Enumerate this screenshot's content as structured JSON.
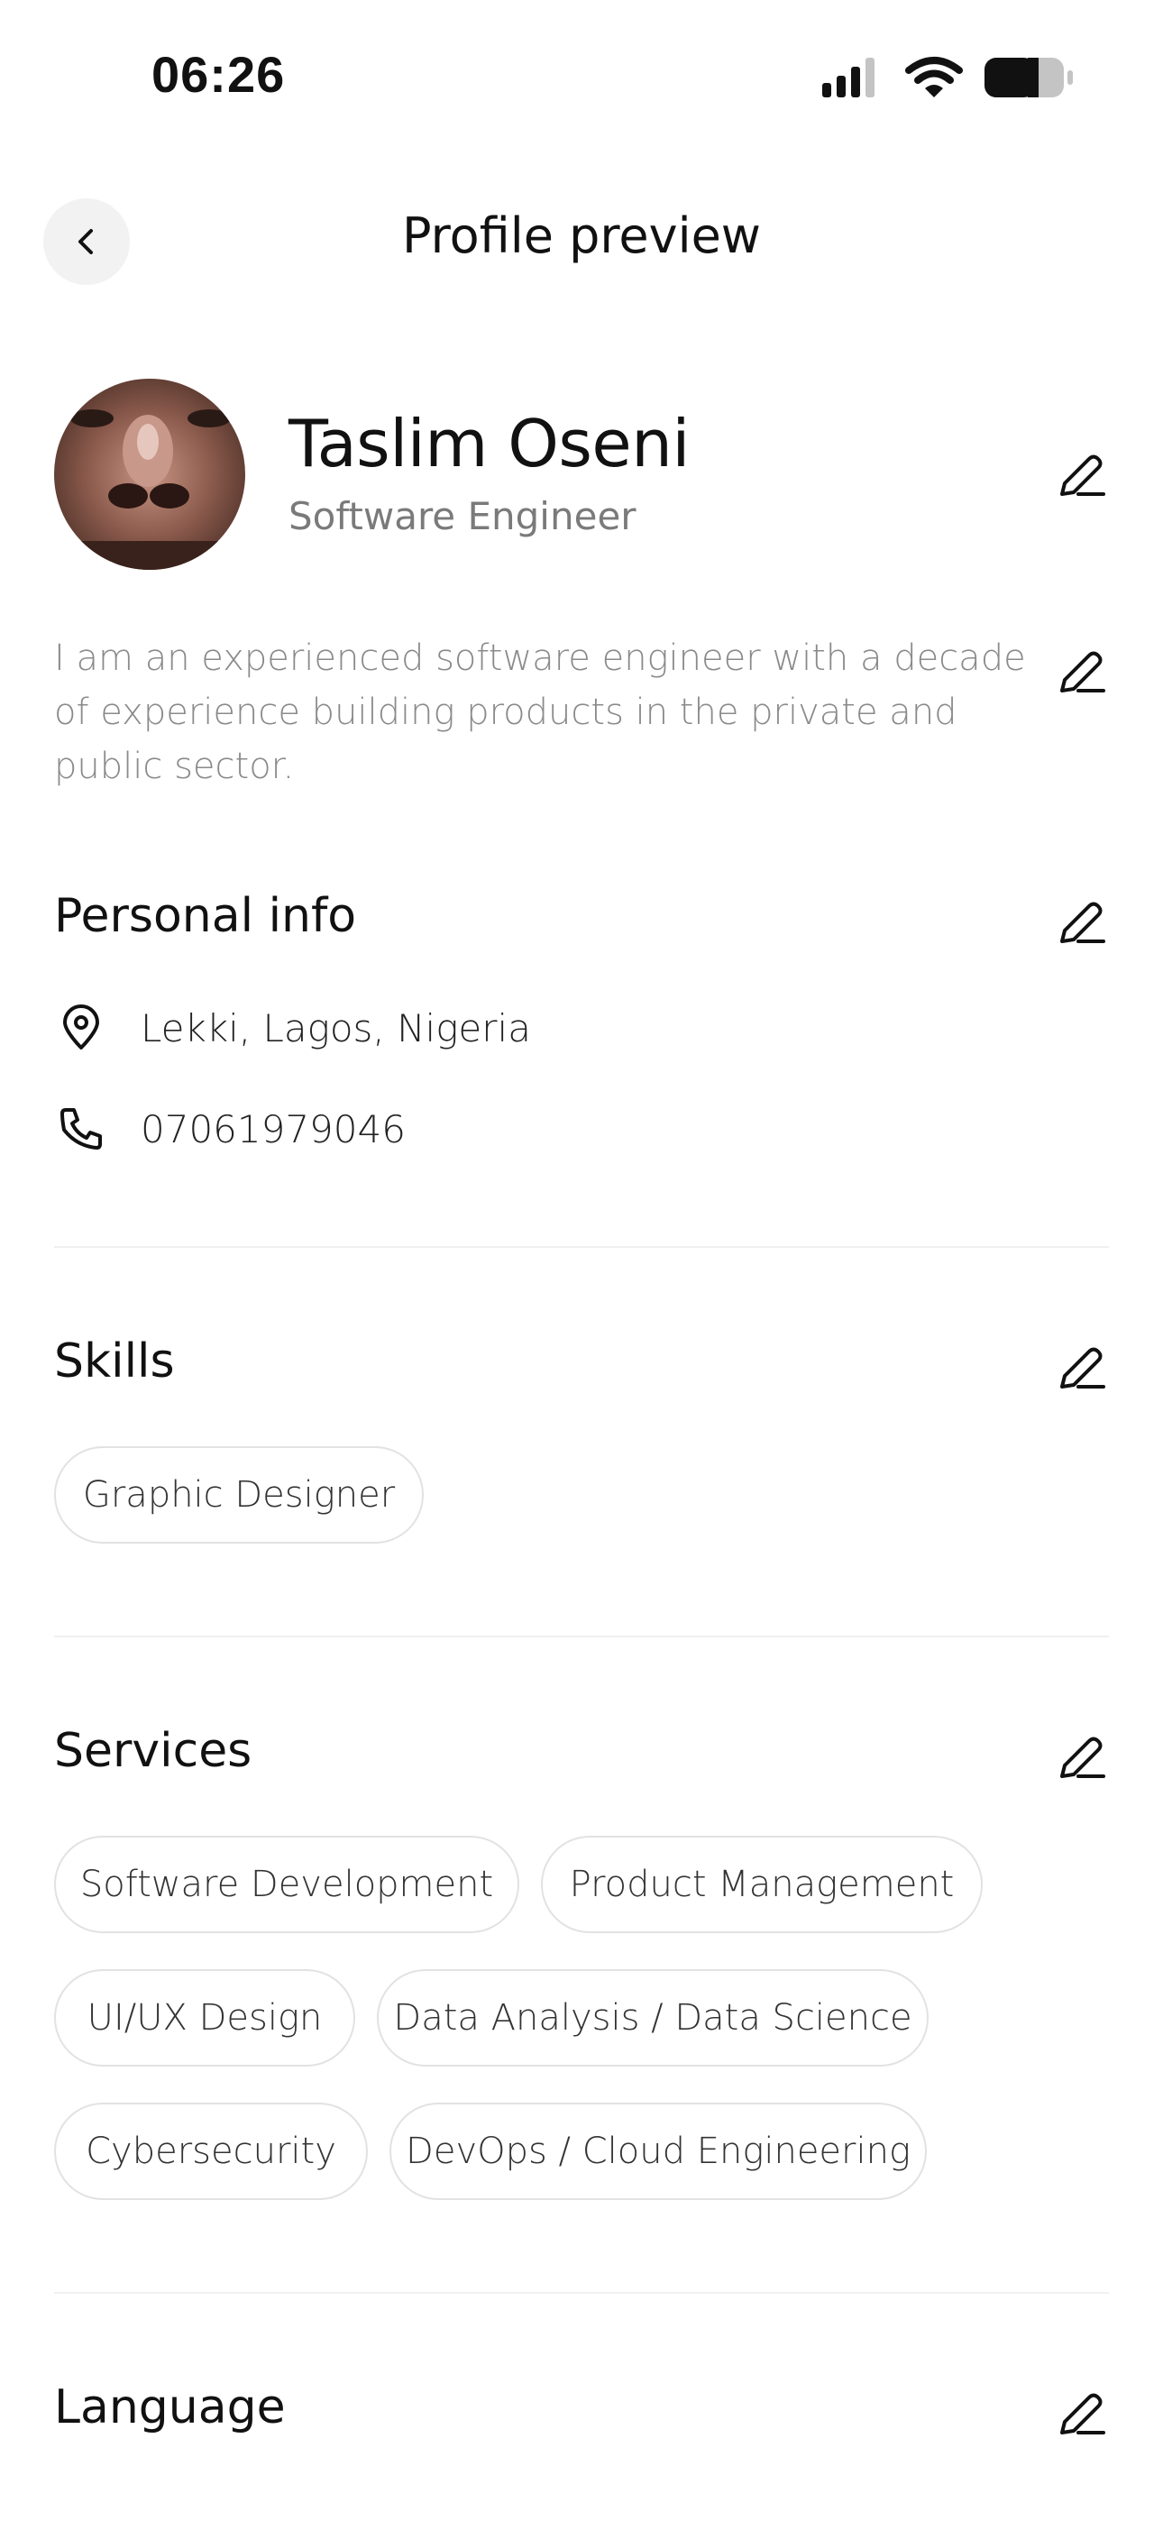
{
  "status_bar": {
    "time": "06:26"
  },
  "header": {
    "title": "Profile preview"
  },
  "profile": {
    "name": "Taslim Oseni",
    "job_title": "Software Engineer",
    "bio": "I am an experienced software engineer with a decade of experience building products in the private and public sector."
  },
  "personal_info": {
    "title": "Personal info",
    "location": "Lekki, Lagos, Nigeria",
    "phone": "07061979046"
  },
  "skills": {
    "title": "Skills",
    "items": [
      "Graphic Designer"
    ]
  },
  "services": {
    "title": "Services",
    "items": [
      "Software Development",
      "Product Management",
      "UI/UX Design",
      "Data Analysis / Data Science",
      "Cybersecurity",
      "DevOps / Cloud Engineering"
    ]
  },
  "language": {
    "title": "Language"
  },
  "icons": {
    "back": "chevron-left-icon",
    "edit": "pencil-icon",
    "location": "map-pin-icon",
    "phone": "phone-icon",
    "signal": "cellular-signal-icon",
    "wifi": "wifi-icon",
    "battery": "battery-icon"
  }
}
